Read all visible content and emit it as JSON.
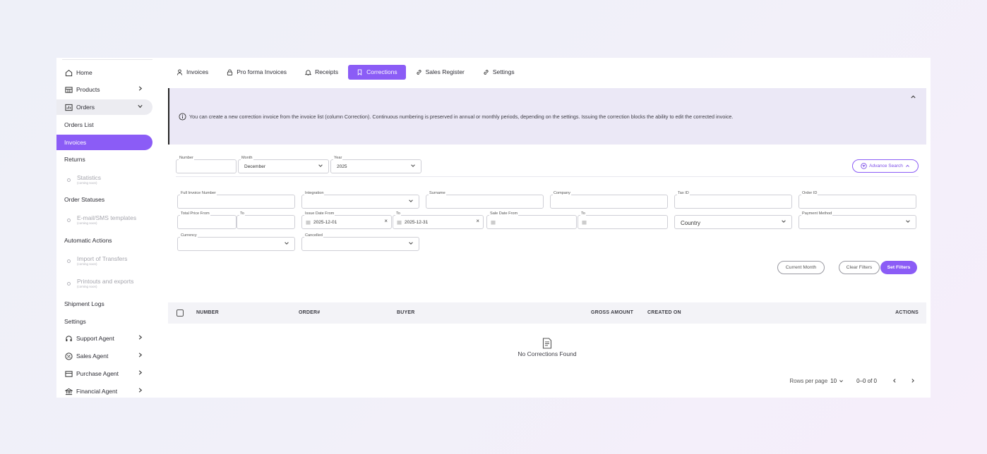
{
  "sidebar": {
    "items": [
      {
        "label": "Home",
        "icon": "home-icon"
      },
      {
        "label": "Products",
        "icon": "products-icon"
      },
      {
        "label": "Orders",
        "icon": "orders-icon"
      },
      {
        "label": "Orders List"
      },
      {
        "label": "Invoices"
      },
      {
        "label": "Returns"
      },
      {
        "label": "Statistics",
        "soon": "(coming soon)"
      },
      {
        "label": "Order Statuses"
      },
      {
        "label": "E-mail/SMS templates",
        "soon": "(coming soon)"
      },
      {
        "label": "Automatic Actions"
      },
      {
        "label": "Import of Transfers",
        "soon": "(coming soon)"
      },
      {
        "label": "Printouts and exports",
        "soon": "(coming soon)"
      },
      {
        "label": "Shipment Logs"
      },
      {
        "label": "Settings"
      },
      {
        "label": "Support Agent",
        "icon": "headset-icon"
      },
      {
        "label": "Sales Agent",
        "icon": "percent-icon"
      },
      {
        "label": "Purchase Agent",
        "icon": "cart-icon"
      },
      {
        "label": "Financial Agent",
        "icon": "bank-icon"
      }
    ]
  },
  "tabs": [
    {
      "label": "Invoices",
      "icon": "user-icon"
    },
    {
      "label": "Pro forma Invoices",
      "icon": "lock-icon"
    },
    {
      "label": "Receipts",
      "icon": "bell-icon"
    },
    {
      "label": "Corrections",
      "icon": "bookmark-icon"
    },
    {
      "label": "Sales Register",
      "icon": "link-icon"
    },
    {
      "label": "Settings",
      "icon": "link-icon"
    }
  ],
  "info": {
    "message": "You can create a new correction invoice from the invoice list (column Correction). Continuous numbering is preserved in annual or monthly periods, depending on the settings. Issuing the correction blocks the ability to edit the corrected invoice."
  },
  "filters": {
    "number_label": "Number",
    "month_label": "Month",
    "month_value": "December",
    "year_label": "Year",
    "year_value": "2025",
    "advanced_search": "Advance Search",
    "full_invoice_number": "Full Invoice Number",
    "integration": "Integration",
    "surname": "Surname",
    "company": "Company",
    "tax_id": "Tax ID",
    "order_id": "Order ID",
    "total_price_from": "Total Price From",
    "to": "To",
    "issue_date_from": "Issue Date From",
    "issue_date_from_value": "2025-12-01",
    "issue_date_to_value": "2025-12-31",
    "sale_date_from": "Sale Date From",
    "country": "Country",
    "payment_method": "Payment Method",
    "currency": "Currency",
    "cancelled": "Cancelled",
    "current_month": "Current Month",
    "clear_filters": "Clear Filters",
    "set_filters": "Set Filters"
  },
  "table": {
    "headers": [
      "NUMBER",
      "ORDER#",
      "BUYER",
      "GROSS AMOUNT",
      "CREATED ON",
      "ACTIONS"
    ],
    "empty": "No Corrections Found"
  },
  "pager": {
    "rows_per_page": "Rows per page",
    "rows_value": "10",
    "range": "0–0 of 0"
  },
  "colors": {
    "accent": "#8b5cf6",
    "info_bg": "#ebe8f6"
  }
}
